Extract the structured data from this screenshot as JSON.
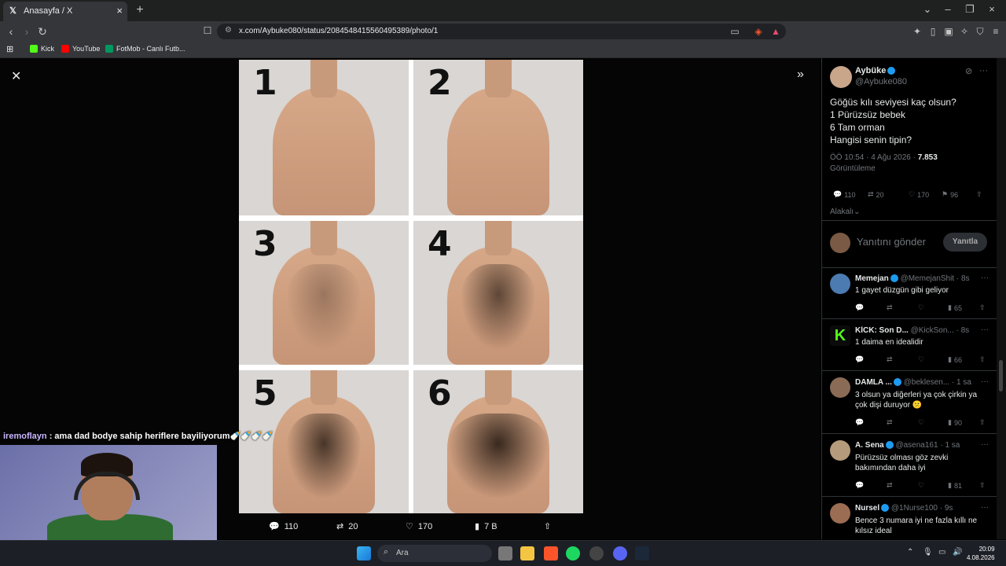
{
  "browser": {
    "tab_title": "Anasayfa / X",
    "url": "x.com/Aybuke080/status/2084548415560495389/photo/1",
    "bookmarks": [
      "Kick",
      "YouTube",
      "FotMob - Canlı Futb..."
    ]
  },
  "viewer": {
    "photo_numbers": [
      "1",
      "2",
      "3",
      "4",
      "5",
      "6"
    ],
    "actions": {
      "replies": "110",
      "reposts": "20",
      "likes": "170",
      "views": "7 B"
    }
  },
  "post": {
    "author_name": "Aybüke",
    "author_handle": "@Aybuke080",
    "text_lines": [
      "Göğüs kılı seviyesi kaç olsun?",
      "1  Pürüzsüz bebek",
      "6 Tam orman",
      "Hangisi senin tipin?"
    ],
    "timestamp": "ÖÖ 10:54 · 4 Ağu 2026 · ",
    "views_count": "7.853",
    "views_label": "Görüntüleme",
    "stats": {
      "replies": "110",
      "reposts": "20",
      "likes": "170",
      "bookmarks": "96"
    },
    "sort_label": "Alakalı",
    "reply_placeholder": "Yanıtını gönder",
    "reply_button": "Yanıtla"
  },
  "replies": [
    {
      "name": "Memejan",
      "handle": "@MemejanShit · 8s",
      "text": "1 gayet düzgün gibi geliyor",
      "views": "65"
    },
    {
      "name": "KİCK: Son D...",
      "handle": "@KickSon... · 8s",
      "text": "1 daima en idealidir",
      "views": "66"
    },
    {
      "name": "DAMLA ...",
      "handle": "@beklesen... · 1 sa",
      "text": "3 olsun ya diğerleri ya çok çirkin ya çok dişi duruyor 😕",
      "views": "90"
    },
    {
      "name": "A. Sena",
      "handle": "@asena161 · 1 sa",
      "text": "Pürüzsüz olması göz zevki bakımından daha iyi",
      "views": "81"
    },
    {
      "name": "Nursel",
      "handle": "@1Nurse100 · 9s",
      "text": "Bence 3 numara iyi ne fazla kıllı ne kılsız ideal",
      "views": ""
    }
  ],
  "stream": {
    "chat_user": "iremoflayn",
    "chat_message": " : ama dad bodye sahip heriflere bayiliyorum🍼🍼🍼🍼"
  },
  "taskbar": {
    "search_label": "Ara",
    "time": "20:09",
    "date": "4.08.2026"
  },
  "colors": {
    "accent": "#1d9bf0",
    "background": "#000000"
  }
}
